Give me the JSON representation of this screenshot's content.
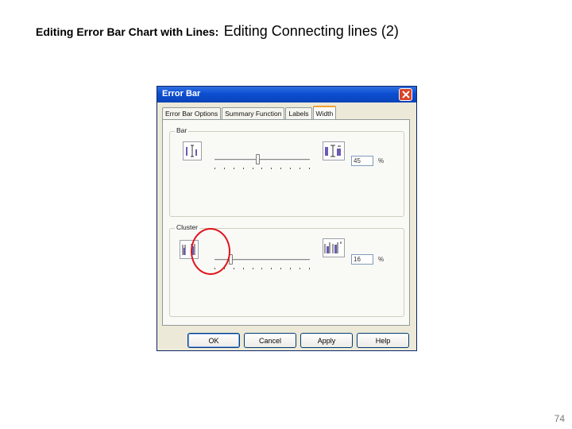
{
  "slide": {
    "title_bold": "Editing Error Bar Chart with Lines:",
    "title_normal": "Editing Connecting lines (2)",
    "page_number": "74"
  },
  "dialog": {
    "title": "Error Bar",
    "tabs": [
      {
        "label": "Error Bar Options",
        "active": false
      },
      {
        "label": "Summary Function",
        "active": false
      },
      {
        "label": "Labels",
        "active": false
      },
      {
        "label": "Width",
        "active": true
      }
    ],
    "bar_group": {
      "legend": "Bar",
      "value": "45",
      "unit": "%",
      "slider_percent": 45
    },
    "cluster_group": {
      "legend": "Cluster",
      "value": "16",
      "unit": "%",
      "slider_percent": 16
    },
    "buttons": {
      "ok": "OK",
      "cancel": "Cancel",
      "apply": "Apply",
      "help": "Help"
    }
  },
  "colors": {
    "highlight": "#e0141c",
    "titlebar": "#0d4fd1",
    "close_button": "#d9442a"
  }
}
